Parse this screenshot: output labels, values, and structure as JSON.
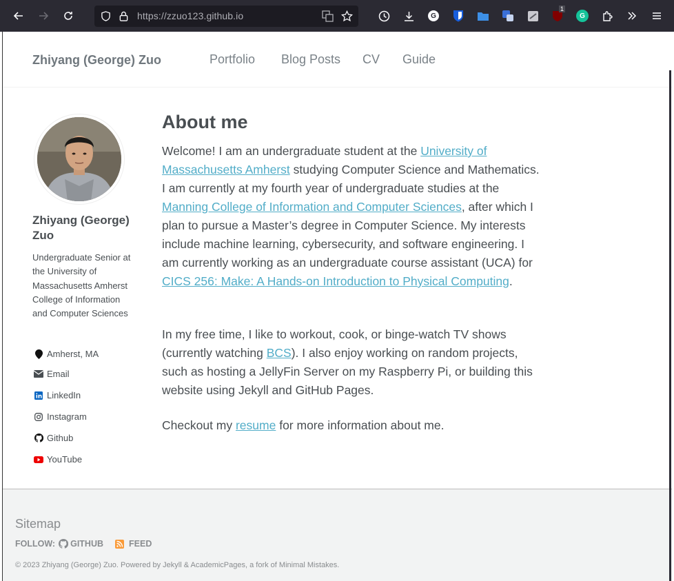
{
  "browser": {
    "url": "https://zzuo123.github.io",
    "extension_labels": {
      "g_ext": "G",
      "grammarly": "G",
      "notif_count": "1"
    }
  },
  "header": {
    "site_title": "Zhiyang (George) Zuo",
    "nav": [
      "Portfolio",
      "Blog Posts",
      "CV",
      "Guide"
    ]
  },
  "author": {
    "name": "Zhiyang (George) Zuo",
    "bio": "Undergraduate Senior at the University of Massachusetts Amherst College of Information and Computer Sciences",
    "links": [
      {
        "label": "Amherst, MA",
        "icon": "map-pin-icon"
      },
      {
        "label": "Email",
        "icon": "envelope-icon"
      },
      {
        "label": "LinkedIn",
        "icon": "linkedin-icon"
      },
      {
        "label": "Instagram",
        "icon": "instagram-icon"
      },
      {
        "label": "Github",
        "icon": "github-icon"
      },
      {
        "label": "YouTube",
        "icon": "youtube-icon"
      }
    ]
  },
  "main": {
    "title": "About me",
    "p1": {
      "t1": "Welcome! I am an undergraduate student at the ",
      "l1": "University of Massachusetts Amherst",
      "t2": " studying Computer Science and Mathematics. I am currently at my fourth year of undergraduate studies at the ",
      "l2": "Manning College of Information and Computer Sciences",
      "t3": ", after which I plan to pursue a Master’s degree in Computer Science. My interests include machine learning, cybersecurity, and software engineering. I am currently working as an undergraduate course assistant (UCA) for ",
      "l3": "CICS 256: Make: A Hands-on Introduction to Physical Computing",
      "t4": "."
    },
    "p2": {
      "t1": "In my free time, I like to workout, cook, or binge-watch TV shows (currently watching ",
      "l1": "BCS",
      "t2": "). I also enjoy working on random projects, such as hosting a JellyFin Server on my Raspberry Pi, or building this website using Jekyll and GitHub Pages."
    },
    "p3": {
      "t1": "Checkout my ",
      "l1": "resume",
      "t2": " for more information about me."
    }
  },
  "footer": {
    "sitemap": "Sitemap",
    "follow_label": "FOLLOW:",
    "github_label": "GITHUB",
    "feed_label": "FEED",
    "copyright": "© 2023 Zhiyang (George) Zuo. Powered by Jekyll & AcademicPages, a fork of Minimal Mistakes."
  },
  "colors": {
    "link": "#52adc8",
    "text": "#494e52",
    "chrome": "#2b2a33",
    "footer_bg": "#f2f3f3"
  }
}
